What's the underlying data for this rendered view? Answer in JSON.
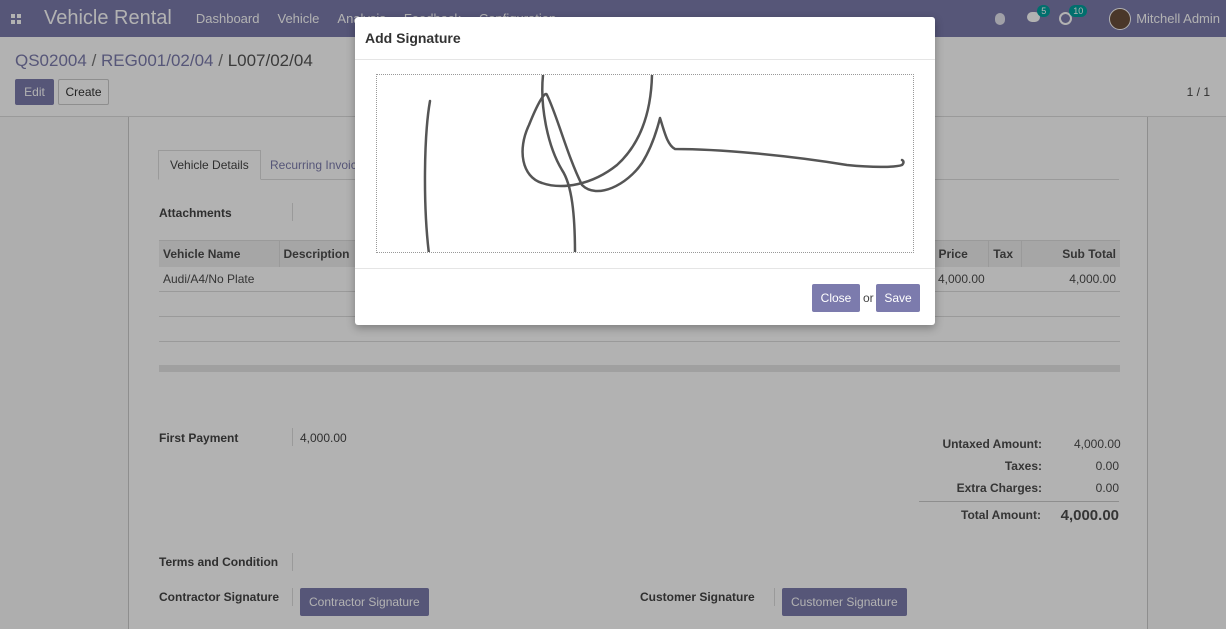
{
  "navbar": {
    "brand": "Vehicle Rental",
    "menu": [
      "Dashboard",
      "Vehicle",
      "Analysis",
      "Feedback",
      "Configuration"
    ],
    "chat_count": "5",
    "activity_count": "10",
    "user_name": "Mitchell Admin"
  },
  "control": {
    "breadcrumb": [
      "QS02004",
      "REG001/02/04",
      "L007/02/04"
    ],
    "edit_label": "Edit",
    "create_label": "Create",
    "pager": "1 / 1"
  },
  "form": {
    "tabs": [
      "Vehicle Details",
      "Recurring Invoices"
    ],
    "attachments_label": "Attachments",
    "lines": {
      "headers": [
        "Vehicle Name",
        "Description",
        "Price",
        "Tax",
        "Sub Total"
      ],
      "rows": [
        {
          "vehicle": "Audi/A4/No Plate",
          "description": "",
          "price": "4,000.00",
          "tax": "",
          "subtotal": "4,000.00"
        }
      ]
    },
    "first_payment_label": "First Payment",
    "first_payment_value": "4,000.00",
    "totals": {
      "untaxed_label": "Untaxed Amount:",
      "untaxed_value": "4,000.00",
      "taxes_label": "Taxes:",
      "taxes_value": "0.00",
      "extra_label": "Extra Charges:",
      "extra_value": "0.00",
      "total_label": "Total Amount:",
      "total_value": "4,000.00"
    },
    "terms_label": "Terms and Condition",
    "contractor_sig_label": "Contractor Signature",
    "contractor_sig_button": "Contractor Signature",
    "customer_sig_label": "Customer Signature",
    "customer_sig_button": "Customer Signature"
  },
  "modal": {
    "title": "Add Signature",
    "close_label": "Close",
    "or_text": "or",
    "save_label": "Save"
  },
  "colors": {
    "brand": "#7c7bad",
    "badge": "#00a09d"
  },
  "icons": {
    "apps": "apps-grid-icon",
    "bug": "bug-icon",
    "chat": "chat-icon",
    "activity": "clock-icon"
  }
}
